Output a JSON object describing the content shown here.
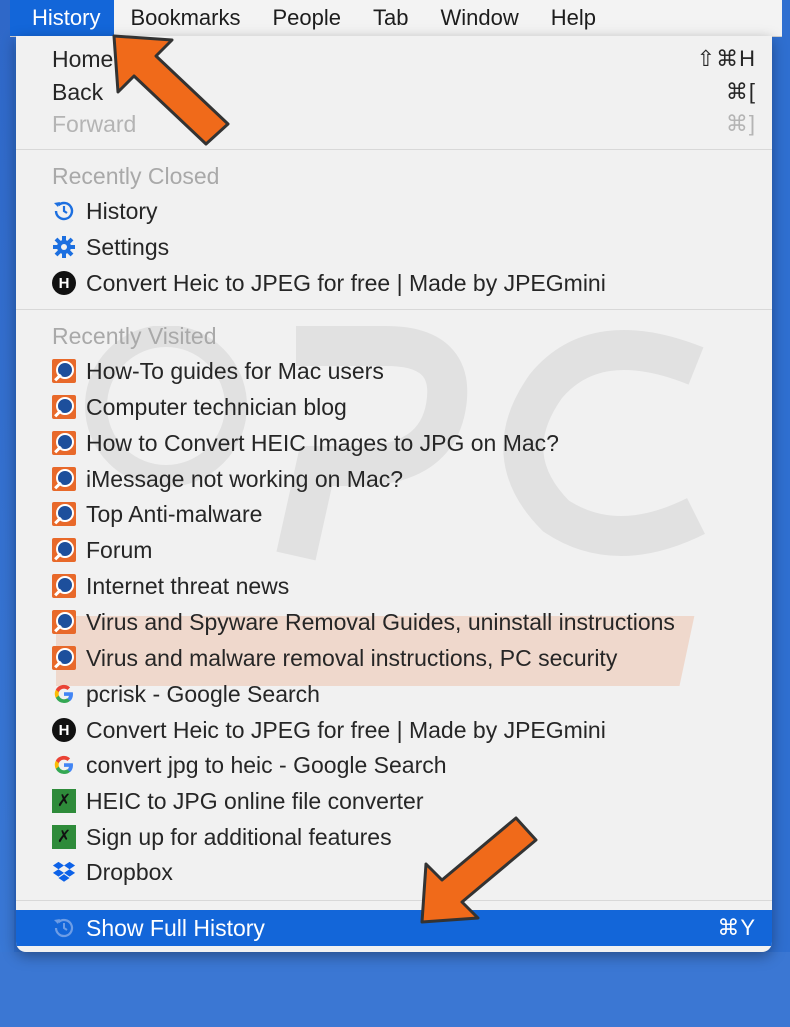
{
  "menubar": {
    "items": [
      {
        "label": "History",
        "active": true
      },
      {
        "label": "Bookmarks"
      },
      {
        "label": "People"
      },
      {
        "label": "Tab"
      },
      {
        "label": "Window"
      },
      {
        "label": "Help"
      }
    ]
  },
  "menu": {
    "nav": [
      {
        "label": "Home",
        "shortcut": "⇧⌘H",
        "enabled": true
      },
      {
        "label": "Back",
        "shortcut": "⌘[",
        "enabled": true
      },
      {
        "label": "Forward",
        "shortcut": "⌘]",
        "enabled": false
      }
    ],
    "recently_closed": {
      "header": "Recently Closed",
      "items": [
        {
          "label": "History",
          "icon": "history-icon"
        },
        {
          "label": "Settings",
          "icon": "gear-icon"
        },
        {
          "label": "Convert Heic to JPEG for free | Made by JPEGmini",
          "icon": "jpegmini-icon"
        }
      ]
    },
    "recently_visited": {
      "header": "Recently Visited",
      "items": [
        {
          "label": "How-To guides for Mac users",
          "icon": "pcrisk-icon"
        },
        {
          "label": "Computer technician blog",
          "icon": "pcrisk-icon"
        },
        {
          "label": "How to Convert HEIC Images to JPG on Mac?",
          "icon": "pcrisk-icon"
        },
        {
          "label": "iMessage not working on Mac?",
          "icon": "pcrisk-icon"
        },
        {
          "label": "Top Anti-malware",
          "icon": "pcrisk-icon"
        },
        {
          "label": "Forum",
          "icon": "pcrisk-icon"
        },
        {
          "label": "Internet threat news",
          "icon": "pcrisk-icon"
        },
        {
          "label": "Virus and Spyware Removal Guides, uninstall instructions",
          "icon": "pcrisk-icon"
        },
        {
          "label": "Virus and malware removal instructions, PC security",
          "icon": "pcrisk-icon"
        },
        {
          "label": "pcrisk - Google Search",
          "icon": "google-icon"
        },
        {
          "label": "Convert Heic to JPEG for free | Made by JPEGmini",
          "icon": "jpegmini-icon"
        },
        {
          "label": "convert jpg to heic - Google Search",
          "icon": "google-icon"
        },
        {
          "label": "HEIC to JPG online file converter",
          "icon": "converter-icon"
        },
        {
          "label": "Sign up for additional features",
          "icon": "converter-icon"
        },
        {
          "label": "Dropbox",
          "icon": "dropbox-icon"
        }
      ]
    },
    "show_full_history": {
      "label": "Show Full History",
      "shortcut": "⌘Y"
    }
  },
  "colors": {
    "accent": "#1366d9",
    "desktop": "#2f6fd0",
    "arrow": "#f06a1a"
  }
}
